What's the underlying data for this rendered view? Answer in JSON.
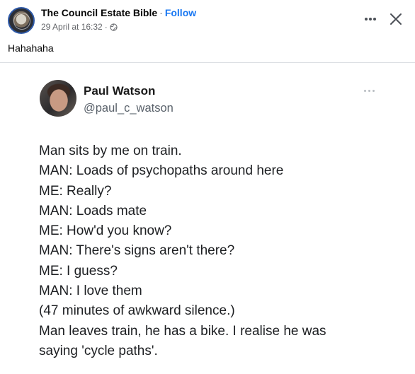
{
  "post": {
    "page_name": "The Council Estate Bible",
    "separator": "·",
    "follow_label": "Follow",
    "timestamp": "29 April at 16:32",
    "meta_separator": "·",
    "privacy_icon": "globe-icon",
    "text": "Hahahaha",
    "more_icon": "more-horizontal-icon",
    "close_icon": "close-icon"
  },
  "tweet": {
    "author_name": "Paul Watson",
    "handle": "@paul_c_watson",
    "more_icon": "more-horizontal-icon",
    "lines": [
      "Man sits by me on train.",
      "MAN: Loads of psychopaths around here",
      "ME: Really?",
      "MAN: Loads mate",
      "ME: How'd you know?",
      "MAN: There's signs aren't there?",
      "ME: I guess?",
      "MAN: I love them",
      "(47 minutes of awkward silence.)",
      "Man leaves train, he has a bike. I realise he was",
      "saying 'cycle paths'."
    ]
  },
  "colors": {
    "accent": "#1877f2",
    "primary_text": "#050505",
    "secondary_text": "#65676b",
    "divider": "#dcdfe3"
  }
}
